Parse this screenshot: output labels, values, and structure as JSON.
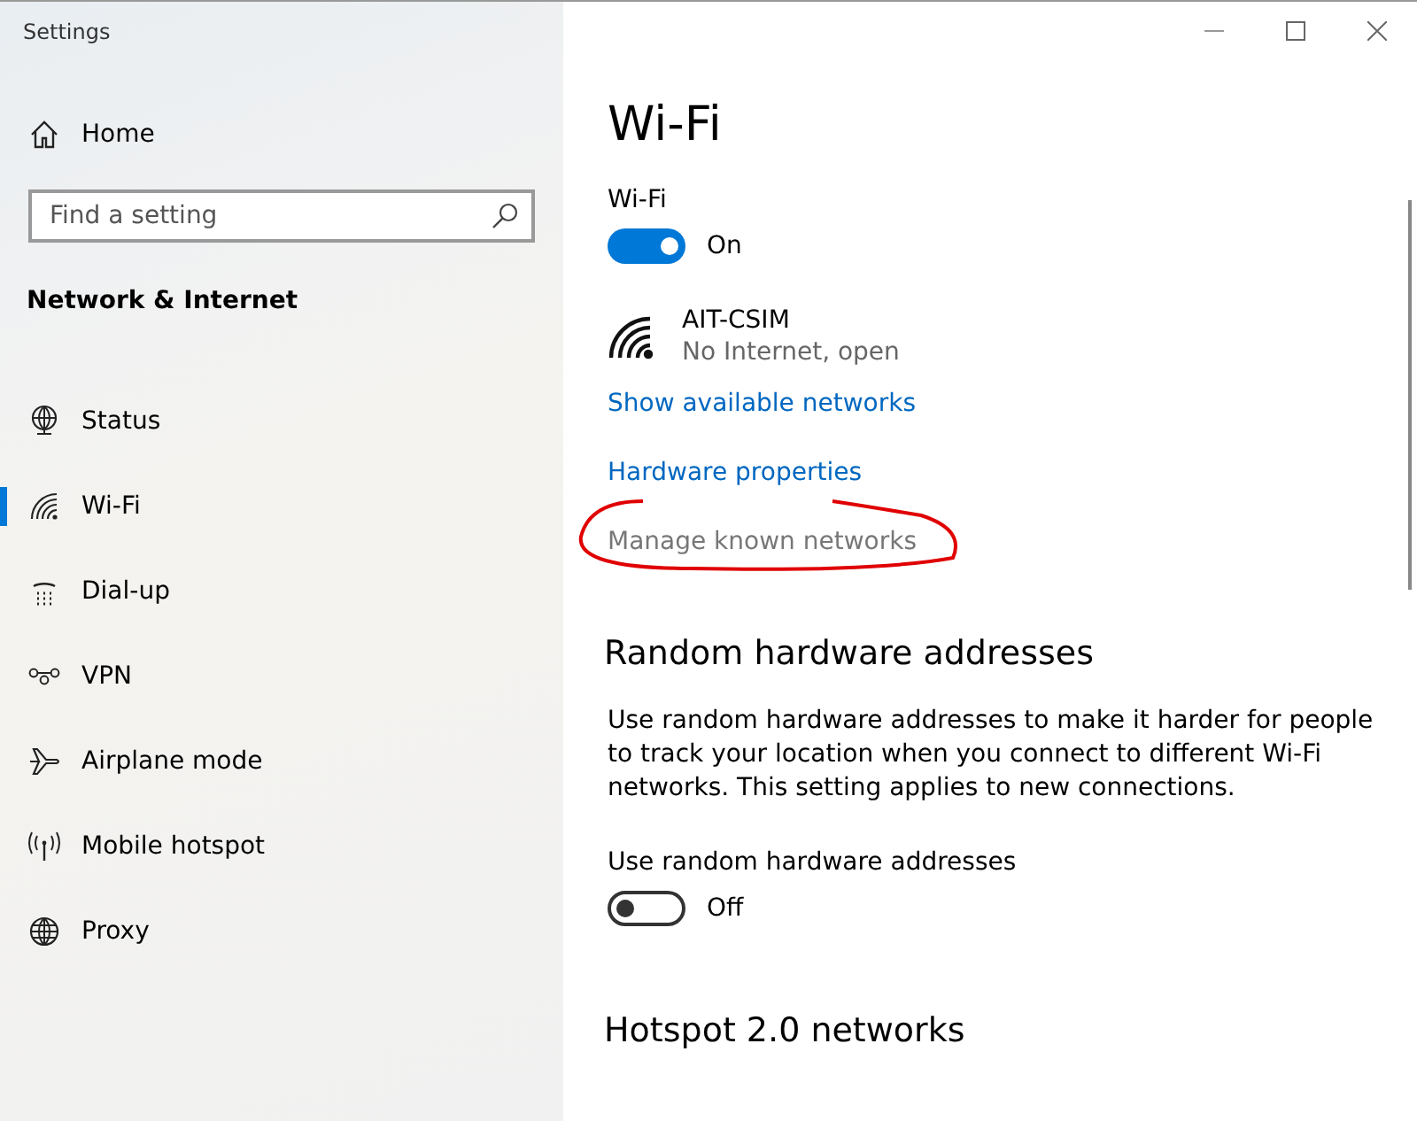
{
  "window": {
    "title": "Settings",
    "controls": [
      {
        "kind": "minimize"
      },
      {
        "kind": "maximize"
      },
      {
        "kind": "close"
      }
    ]
  },
  "sidebar": {
    "home": {
      "label": "Home"
    },
    "search": {
      "placeholder": "Find a setting"
    },
    "section_title": "Network & Internet",
    "items": [
      {
        "label": "Status",
        "kind": "status",
        "selected": false
      },
      {
        "label": "Wi-Fi",
        "kind": "wifi",
        "selected": true
      },
      {
        "label": "Dial-up",
        "kind": "dialup",
        "selected": false
      },
      {
        "label": "VPN",
        "kind": "vpn",
        "selected": false
      },
      {
        "label": "Airplane mode",
        "kind": "airplane",
        "selected": false
      },
      {
        "label": "Mobile hotspot",
        "kind": "hotspot",
        "selected": false
      },
      {
        "label": "Proxy",
        "kind": "proxy",
        "selected": false
      }
    ]
  },
  "content": {
    "title": "Wi-Fi",
    "wifi_toggle": {
      "label": "Wi-Fi",
      "on": true,
      "state_text": "On"
    },
    "network": {
      "name": "AIT-CSIM",
      "status": "No Internet, open"
    },
    "links": [
      {
        "label": "Show available networks",
        "disabled": false,
        "circled": false
      },
      {
        "label": "Hardware properties",
        "disabled": false,
        "circled": false
      },
      {
        "label": "Manage known networks",
        "disabled": true,
        "circled": true
      }
    ],
    "sections": [
      {
        "heading": "Random hardware addresses",
        "description": "Use random hardware addresses to make it harder for people to track your location when you connect to different Wi-Fi networks. This setting applies to new connections.",
        "toggle": {
          "label": "Use random hardware addresses",
          "on": false,
          "state_text": "Off"
        }
      },
      {
        "heading": "Hotspot 2.0 networks"
      }
    ]
  }
}
